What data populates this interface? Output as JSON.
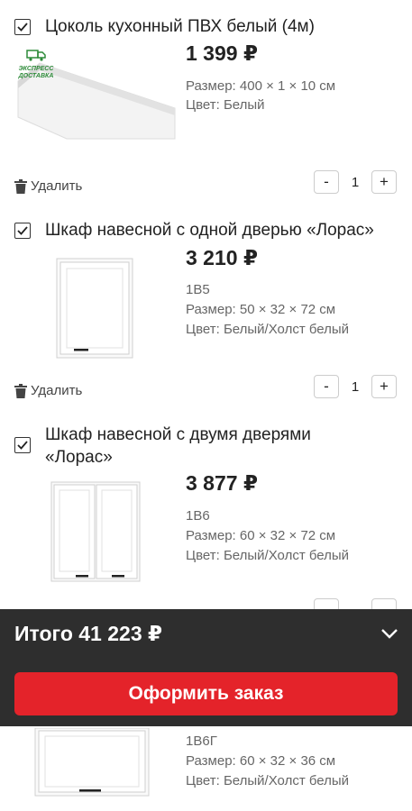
{
  "items": [
    {
      "title": "Цоколь кухонный ПВХ белый (4м)",
      "price": "1 399 ₽",
      "size": "Размер: 400 × 1 × 10 см",
      "color": "Цвет: Белый",
      "badge": "ЭКСПРЕСС ДОСТАВКА",
      "qty": "1"
    },
    {
      "title": "Шкаф навесной с одной дверью «Лорас»",
      "price": "3 210 ₽",
      "code": "1В5",
      "size": "Размер: 50 × 32 × 72 см",
      "color": "Цвет: Белый/Холст белый",
      "qty": "1"
    },
    {
      "title": "Шкаф навесной с двумя дверями «Лорас»",
      "price": "3 877 ₽",
      "code": "1В6",
      "size": "Размер: 60 × 32 × 72 см",
      "color": "Цвет: Белый/Холст белый"
    },
    {
      "code": "1В6Г",
      "size": "Размер: 60 × 32 × 36 см",
      "color": "Цвет: Белый/Холст белый"
    }
  ],
  "labels": {
    "delete": "Удалить",
    "minus": "-",
    "plus": "+"
  },
  "summary": {
    "total": "Итого 41 223 ₽",
    "order_button": "Оформить заказ"
  },
  "colors": {
    "accent": "#e4232a",
    "bar": "#2e2e2e",
    "badge": "#2e8b3a"
  }
}
